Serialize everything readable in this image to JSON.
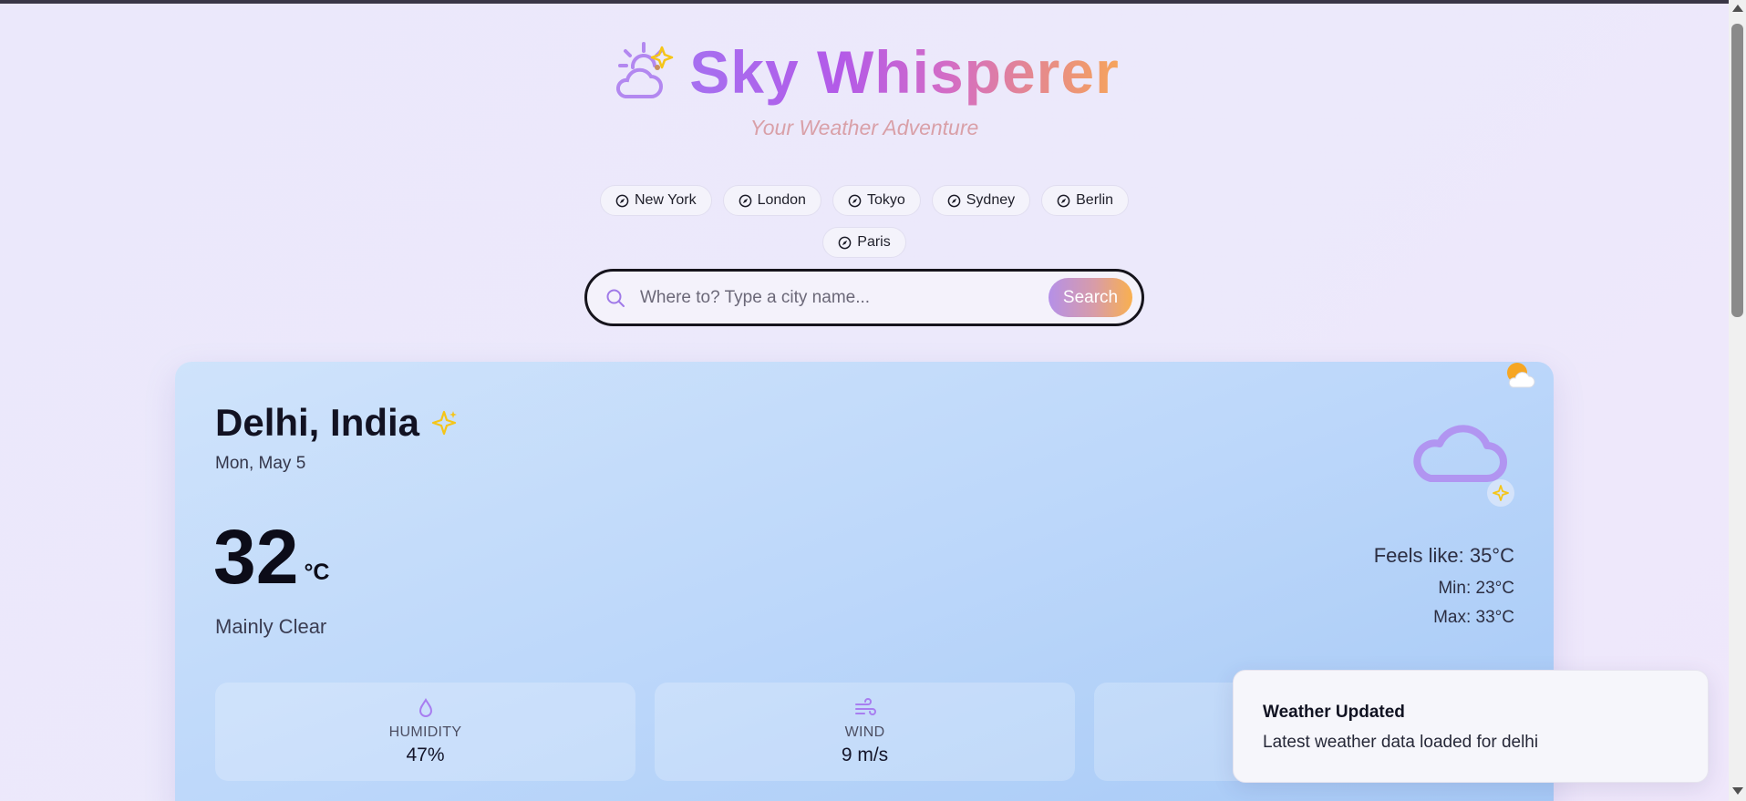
{
  "app": {
    "title": "Sky Whisperer",
    "subtitle": "Your Weather Adventure",
    "logo_icon": "cloud-sun-sparkle-icon"
  },
  "quick_cities": [
    {
      "label": "New York",
      "icon": "compass-icon"
    },
    {
      "label": "London",
      "icon": "compass-icon"
    },
    {
      "label": "Tokyo",
      "icon": "compass-icon"
    },
    {
      "label": "Sydney",
      "icon": "compass-icon"
    },
    {
      "label": "Berlin",
      "icon": "compass-icon"
    },
    {
      "label": "Paris",
      "icon": "compass-icon"
    }
  ],
  "search": {
    "placeholder": "Where to? Type a city name...",
    "value": "",
    "button_label": "Search"
  },
  "weather": {
    "city": "Delhi, India",
    "date": "Mon, May 5",
    "temperature": "32",
    "unit": "°C",
    "condition": "Mainly Clear",
    "feels_like": "Feels like: 35°C",
    "min": "Min: 23°C",
    "max": "Max: 33°C",
    "stats": [
      {
        "label": "HUMIDITY",
        "value": "47%",
        "icon": "droplet-icon"
      },
      {
        "label": "WIND",
        "value": "9 m/s",
        "icon": "wind-icon"
      }
    ]
  },
  "toast": {
    "title": "Weather Updated",
    "message": "Latest weather data loaded for delhi"
  },
  "colors": {
    "accent_purple": "#a670f0",
    "accent_orange": "#f6a45a",
    "card_blue": "#bcd7fa",
    "sparkle_yellow": "#f5c518"
  }
}
